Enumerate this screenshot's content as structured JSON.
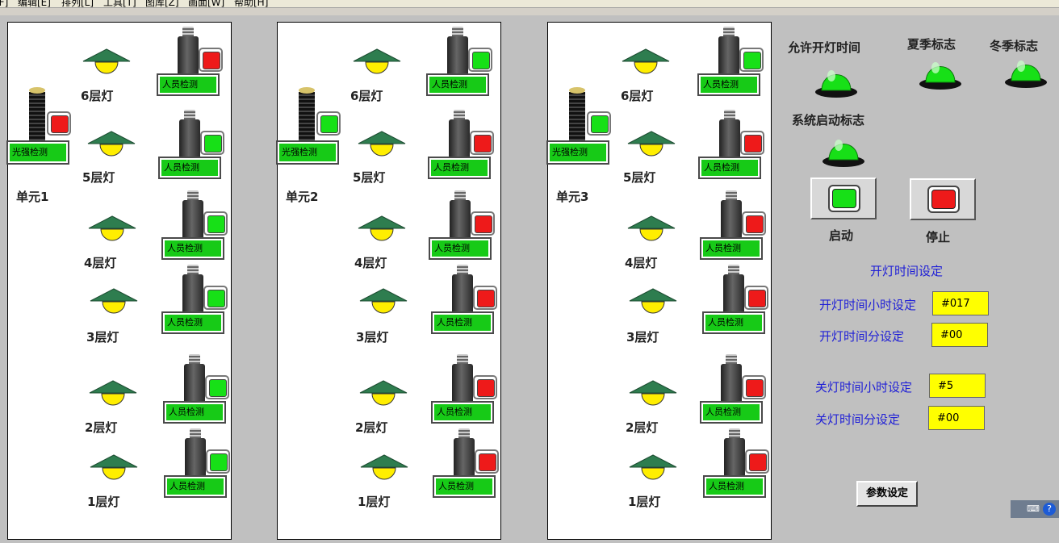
{
  "menu": [
    {
      "label": "文件[F]"
    },
    {
      "label": "编辑[E]"
    },
    {
      "label": "排列[L]"
    },
    {
      "label": "工具[T]"
    },
    {
      "label": "图库[Z]"
    },
    {
      "label": "画面[W]"
    },
    {
      "label": "帮助[H]"
    }
  ],
  "colors": {
    "on": "#17e017",
    "off": "#ee1a1a",
    "lamp_shade": "#2e7d4f",
    "lamp_bulb": "#ffee00"
  },
  "units": [
    {
      "name": "单元1",
      "light_sensor": {
        "label": "光强检测",
        "state": "off"
      },
      "floors": [
        {
          "label": "6层灯",
          "sensor_label": "人员检测",
          "state": "off"
        },
        {
          "label": "5层灯",
          "sensor_label": "人员检测",
          "state": "on"
        },
        {
          "label": "4层灯",
          "sensor_label": "人员检测",
          "state": "on"
        },
        {
          "label": "3层灯",
          "sensor_label": "人员检测",
          "state": "on"
        },
        {
          "label": "2层灯",
          "sensor_label": "人员检测",
          "state": "on"
        },
        {
          "label": "1层灯",
          "sensor_label": "人员检测",
          "state": "on"
        }
      ]
    },
    {
      "name": "单元2",
      "light_sensor": {
        "label": "光强检测",
        "state": "on"
      },
      "floors": [
        {
          "label": "6层灯",
          "sensor_label": "人员检测",
          "state": "on"
        },
        {
          "label": "5层灯",
          "sensor_label": "人员检测",
          "state": "off"
        },
        {
          "label": "4层灯",
          "sensor_label": "人员检测",
          "state": "off"
        },
        {
          "label": "3层灯",
          "sensor_label": "人员检测",
          "state": "off"
        },
        {
          "label": "2层灯",
          "sensor_label": "人员检测",
          "state": "off"
        },
        {
          "label": "1层灯",
          "sensor_label": "人员检测",
          "state": "off"
        }
      ]
    },
    {
      "name": "单元3",
      "light_sensor": {
        "label": "光强检测",
        "state": "on"
      },
      "floors": [
        {
          "label": "6层灯",
          "sensor_label": "人员检测",
          "state": "on"
        },
        {
          "label": "5层灯",
          "sensor_label": "人员检测",
          "state": "off"
        },
        {
          "label": "4层灯",
          "sensor_label": "人员检测",
          "state": "off"
        },
        {
          "label": "3层灯",
          "sensor_label": "人员检测",
          "state": "off"
        },
        {
          "label": "2层灯",
          "sensor_label": "人员检测",
          "state": "off"
        },
        {
          "label": "1层灯",
          "sensor_label": "人员检测",
          "state": "off"
        }
      ]
    }
  ],
  "flags": {
    "allow_time": {
      "title": "允许开灯时间",
      "state": "on"
    },
    "summer": {
      "title": "夏季标志",
      "state": "on"
    },
    "winter": {
      "title": "冬季标志",
      "state": "on"
    },
    "system_start": {
      "title": "系统启动标志",
      "state": "on"
    }
  },
  "controls": {
    "start": {
      "label": "启动",
      "color": "on"
    },
    "stop": {
      "label": "停止",
      "color": "off"
    }
  },
  "settings": {
    "title": "开灯时间设定",
    "on_hour": {
      "label": "开灯时间小时设定",
      "value": "#017"
    },
    "on_minute": {
      "label": "开灯时间分设定",
      "value": "#00"
    },
    "off_hour": {
      "label": "关灯时间小时设定",
      "value": "#5"
    },
    "off_minute": {
      "label": "关灯时间分设定",
      "value": "#00"
    }
  },
  "param_button": "参数设定",
  "tray": {
    "keyboard_icon": "keyboard-icon",
    "help_icon": "help-icon"
  }
}
